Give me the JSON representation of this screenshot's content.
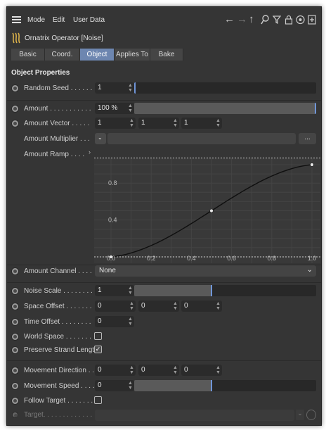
{
  "menubar": {
    "items": [
      "Mode",
      "Edit",
      "User Data"
    ]
  },
  "toolbar_icons": [
    "back-arrow-icon",
    "forward-arrow-icon",
    "up-arrow-icon",
    "search-icon",
    "filter-icon",
    "lock-icon",
    "target-icon",
    "new-panel-icon"
  ],
  "object": {
    "title": "Ornatrix Operator [Noise]"
  },
  "tabs": [
    {
      "label": "Basic",
      "active": false
    },
    {
      "label": "Coord.",
      "active": false
    },
    {
      "label": "Object",
      "active": true
    },
    {
      "label": "Applies To",
      "active": false
    },
    {
      "label": "Bake",
      "active": false
    }
  ],
  "section_title": "Object Properties",
  "params": {
    "random_seed": {
      "label": "Random Seed . . . . . .",
      "value": "1",
      "slider": 0.0
    },
    "amount": {
      "label": "Amount . . . . . . . . . . .",
      "value": "100 %",
      "slider": 1.0
    },
    "amount_vector": {
      "label": "Amount Vector . . . . .",
      "x": "1",
      "y": "1",
      "z": "1"
    },
    "amount_multiplier": {
      "label": "Amount Multiplier . . .",
      "button": "..."
    },
    "amount_ramp": {
      "label": "Amount Ramp . . . ."
    },
    "amount_channel": {
      "label": "Amount Channel . . . .",
      "value": "None"
    },
    "noise_scale": {
      "label": "Noise Scale . . . . . . . .",
      "value": "1",
      "slider": 0.43
    },
    "space_offset": {
      "label": "Space Offset . . . . . . .",
      "x": "0",
      "y": "0",
      "z": "0"
    },
    "time_offset": {
      "label": "Time Offset . . . . . . . .",
      "value": "0"
    },
    "world_space": {
      "label": "World Space . . . . . . .",
      "checked": false
    },
    "preserve_strand_length": {
      "label": "Preserve Strand Length",
      "checked": true
    },
    "movement_direction": {
      "label": "Movement Direction . .",
      "x": "0",
      "y": "0",
      "z": "0"
    },
    "movement_speed": {
      "label": "Movement Speed . . . .",
      "value": "0",
      "slider": 0.43
    },
    "follow_target": {
      "label": "Follow Target . . . . . . .",
      "checked": false
    },
    "target": {
      "label": "Target. . . . . . . . . . . . ."
    }
  },
  "ramp": {
    "x_ticks": [
      "0.0",
      "0.2",
      "0.4",
      "0.6",
      "0.8",
      "1.0"
    ],
    "y_ticks": [
      "0.8",
      "0.4"
    ],
    "points": [
      [
        0,
        0
      ],
      [
        0.5,
        0.5
      ],
      [
        1,
        1
      ]
    ]
  },
  "colors": {
    "accent": "#6d86b0",
    "slider_thumb": "#6f95d8",
    "panel": "#353535",
    "field": "#2b2b2b"
  }
}
